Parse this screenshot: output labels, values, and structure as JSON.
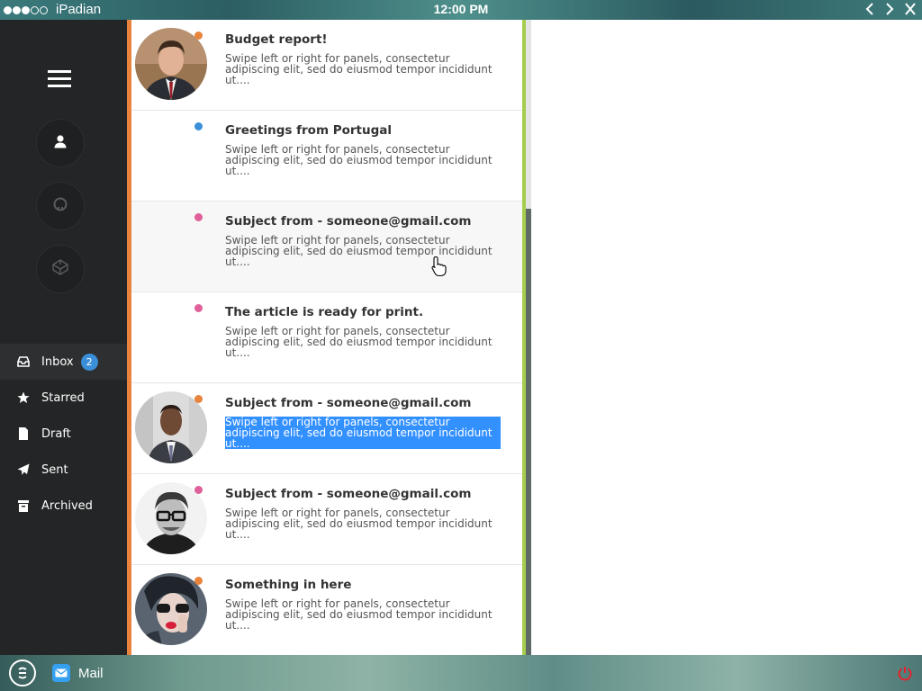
{
  "status_bar": {
    "signal_full_dots": 3,
    "signal_total_dots": 5,
    "carrier": "iPadian",
    "time": "12:00 PM",
    "back_icon": "chevron-left-icon",
    "forward_icon": "chevron-right-icon",
    "close_icon": "close-icon"
  },
  "sidebar": {
    "menu_icon": "hamburger-menu-icon",
    "circle_buttons": [
      {
        "icon": "user-icon"
      },
      {
        "icon": "github-icon"
      },
      {
        "icon": "codepen-icon"
      }
    ],
    "items": [
      {
        "label": "Inbox",
        "icon": "inbox-icon",
        "badge": "2",
        "active": true
      },
      {
        "label": "Starred",
        "icon": "star-icon"
      },
      {
        "label": "Draft",
        "icon": "file-icon"
      },
      {
        "label": "Sent",
        "icon": "paper-plane-icon"
      },
      {
        "label": "Archived",
        "icon": "archive-icon"
      }
    ]
  },
  "messages": [
    {
      "title": "Budget report!",
      "body": "Swipe left or right for panels, consectetur adipiscing elit, sed do eiusmod tempor incididunt ut....",
      "dot_color": "#e8843c",
      "avatar": "man-in-suit-avatar"
    },
    {
      "title": "Greetings from Portugal",
      "body": "Swipe left or right for panels, consectetur adipiscing elit, sed do eiusmod tempor incididunt ut....",
      "dot_color": "#3a8fd8",
      "avatar": null
    },
    {
      "title": "Subject from - someone@gmail.com",
      "body": "Swipe left or right for panels, consectetur adipiscing elit, sed do eiusmod tempor incididunt ut....",
      "dot_color": "#e0609a",
      "avatar": null
    },
    {
      "title": "The article is ready for print.",
      "body": "Swipe left or right for panels, consectetur adipiscing elit, sed do eiusmod tempor incididunt ut....",
      "dot_color": "#e0609a",
      "avatar": null
    },
    {
      "title": "Subject from - someone@gmail.com",
      "body": "Swipe left or right for panels, consectetur adipiscing elit, sed do eiusmod tempor incididunt ut....",
      "dot_color": "#e8843c",
      "avatar": "businessman-avatar",
      "selected": true
    },
    {
      "title": "Subject from - someone@gmail.com",
      "body": "Swipe left or right for panels, consectetur adipiscing elit, sed do eiusmod tempor incididunt ut....",
      "dot_color": "#e0609a",
      "avatar": "man-with-glasses-avatar"
    },
    {
      "title": "Something in here",
      "body": "Swipe left or right for panels, consectetur adipiscing elit, sed do eiusmod tempor incididunt ut....",
      "dot_color": "#e8843c",
      "avatar": "woman-with-sunglasses-avatar"
    }
  ],
  "taskbar": {
    "start_icon": "ipadian-logo-icon",
    "app_icon": "mail-icon",
    "app_label": "Mail",
    "power_icon": "power-icon"
  },
  "colors": {
    "sidebar_bg": "#242526",
    "accent_orange": "#e8843c",
    "accent_green": "#a6cc4e",
    "badge_blue": "#3a8fd8",
    "selection_blue": "#3390ff"
  }
}
